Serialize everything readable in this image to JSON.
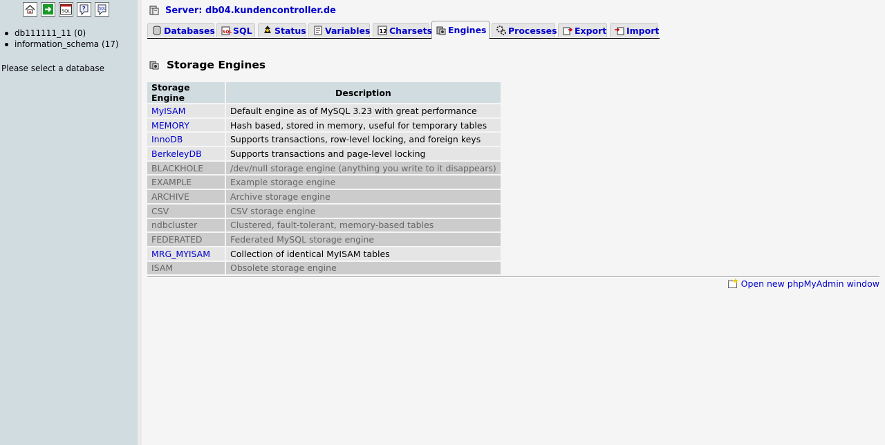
{
  "left": {
    "icons": [
      "home-icon",
      "exit-icon",
      "sql-query-icon",
      "documentation-icon",
      "sql-documentation-icon"
    ],
    "databases": [
      {
        "name": "db111111_11",
        "count": "(0)"
      },
      {
        "name": "information_schema",
        "count": "(17)"
      }
    ],
    "select_prompt": "Please select a database"
  },
  "server": {
    "label": "Server: db04.kundencontroller.de"
  },
  "tabs": [
    {
      "label": "Databases",
      "icon": "databases-icon",
      "active": false
    },
    {
      "label": "SQL",
      "icon": "sql-icon",
      "active": false
    },
    {
      "label": "Status",
      "icon": "status-icon",
      "active": false
    },
    {
      "label": "Variables",
      "icon": "variables-icon",
      "active": false
    },
    {
      "label": "Charsets",
      "icon": "charsets-icon",
      "active": false
    },
    {
      "label": "Engines",
      "icon": "engines-icon",
      "active": true
    },
    {
      "label": "Processes",
      "icon": "processes-icon",
      "active": false
    },
    {
      "label": "Export",
      "icon": "export-icon",
      "active": false
    },
    {
      "label": "Import",
      "icon": "import-icon",
      "active": false
    }
  ],
  "section": {
    "title": "Storage Engines"
  },
  "table": {
    "headers": [
      "Storage Engine",
      "Description"
    ],
    "rows": [
      {
        "engine": "MyISAM",
        "description": "Default engine as of MySQL 3.23 with great performance",
        "enabled": true
      },
      {
        "engine": "MEMORY",
        "description": "Hash based, stored in memory, useful for temporary tables",
        "enabled": true
      },
      {
        "engine": "InnoDB",
        "description": "Supports transactions, row-level locking, and foreign keys",
        "enabled": true
      },
      {
        "engine": "BerkeleyDB",
        "description": "Supports transactions and page-level locking",
        "enabled": true
      },
      {
        "engine": "BLACKHOLE",
        "description": "/dev/null storage engine (anything you write to it disappears)",
        "enabled": false
      },
      {
        "engine": "EXAMPLE",
        "description": "Example storage engine",
        "enabled": false
      },
      {
        "engine": "ARCHIVE",
        "description": "Archive storage engine",
        "enabled": false
      },
      {
        "engine": "CSV",
        "description": "CSV storage engine",
        "enabled": false
      },
      {
        "engine": "ndbcluster",
        "description": "Clustered, fault-tolerant, memory-based tables",
        "enabled": false
      },
      {
        "engine": "FEDERATED",
        "description": "Federated MySQL storage engine",
        "enabled": false
      },
      {
        "engine": "MRG_MYISAM",
        "description": "Collection of identical MyISAM tables",
        "enabled": true
      },
      {
        "engine": "ISAM",
        "description": "Obsolete storage engine",
        "enabled": false
      }
    ]
  },
  "footer": {
    "new_window_link": "Open new phpMyAdmin window"
  },
  "colors": {
    "link": "#0000cc",
    "nav_bg": "#d0dce0",
    "page_bg": "#f5f5f5",
    "row_enabled": "#e5e5e5",
    "row_disabled": "#cccccc"
  }
}
